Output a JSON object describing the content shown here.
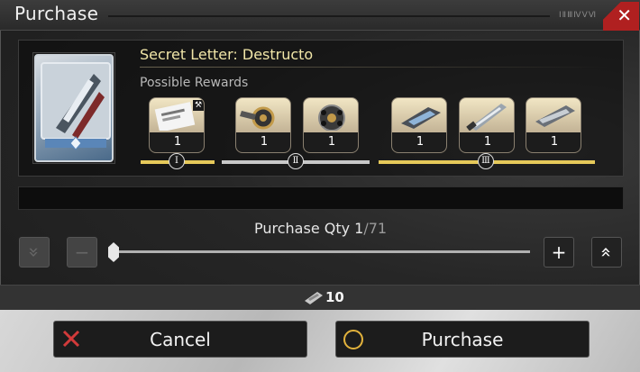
{
  "dialog": {
    "title": "Purchase",
    "close_glyph": "✕",
    "title_decoration": "ⅠⅡⅢⅣⅤⅥ"
  },
  "item": {
    "name": "Secret Letter: Destructo",
    "rewards_label": "Possible Rewards",
    "icon": "secret-letter-icon"
  },
  "rewards": [
    {
      "tier": "Ⅰ",
      "qty": "1",
      "icon": "letter-icon"
    },
    {
      "tier": "Ⅱ",
      "qty": "1",
      "icon": "gear-weapon-icon"
    },
    {
      "tier": "Ⅱ",
      "qty": "1",
      "icon": "orb-icon"
    },
    {
      "tier": "Ⅲ",
      "qty": "1",
      "icon": "gauntlet-icon"
    },
    {
      "tier": "Ⅲ",
      "qty": "1",
      "icon": "sword-icon"
    },
    {
      "tier": "Ⅲ",
      "qty": "1",
      "icon": "scroll-icon"
    }
  ],
  "tiers": [
    {
      "label": "Ⅰ",
      "color": "#e6c95a"
    },
    {
      "label": "Ⅱ",
      "color": "#c8c8c8"
    },
    {
      "label": "Ⅲ",
      "color": "#e6c95a"
    }
  ],
  "quantity": {
    "label": "Purchase Qty ",
    "current": "1",
    "max": "71",
    "slider_fraction": 0.0
  },
  "controls": {
    "min_glyph": "»",
    "minus_glyph": "−",
    "plus_glyph": "+",
    "max_glyph": "«"
  },
  "cost": {
    "value": "10",
    "icon": "currency-icon"
  },
  "buttons": {
    "cancel_label": "Cancel",
    "purchase_label": "Purchase"
  },
  "colors": {
    "cancel_x": "#d23a3a",
    "purchase_o": "#e2b23c",
    "close_red": "#b02020"
  }
}
